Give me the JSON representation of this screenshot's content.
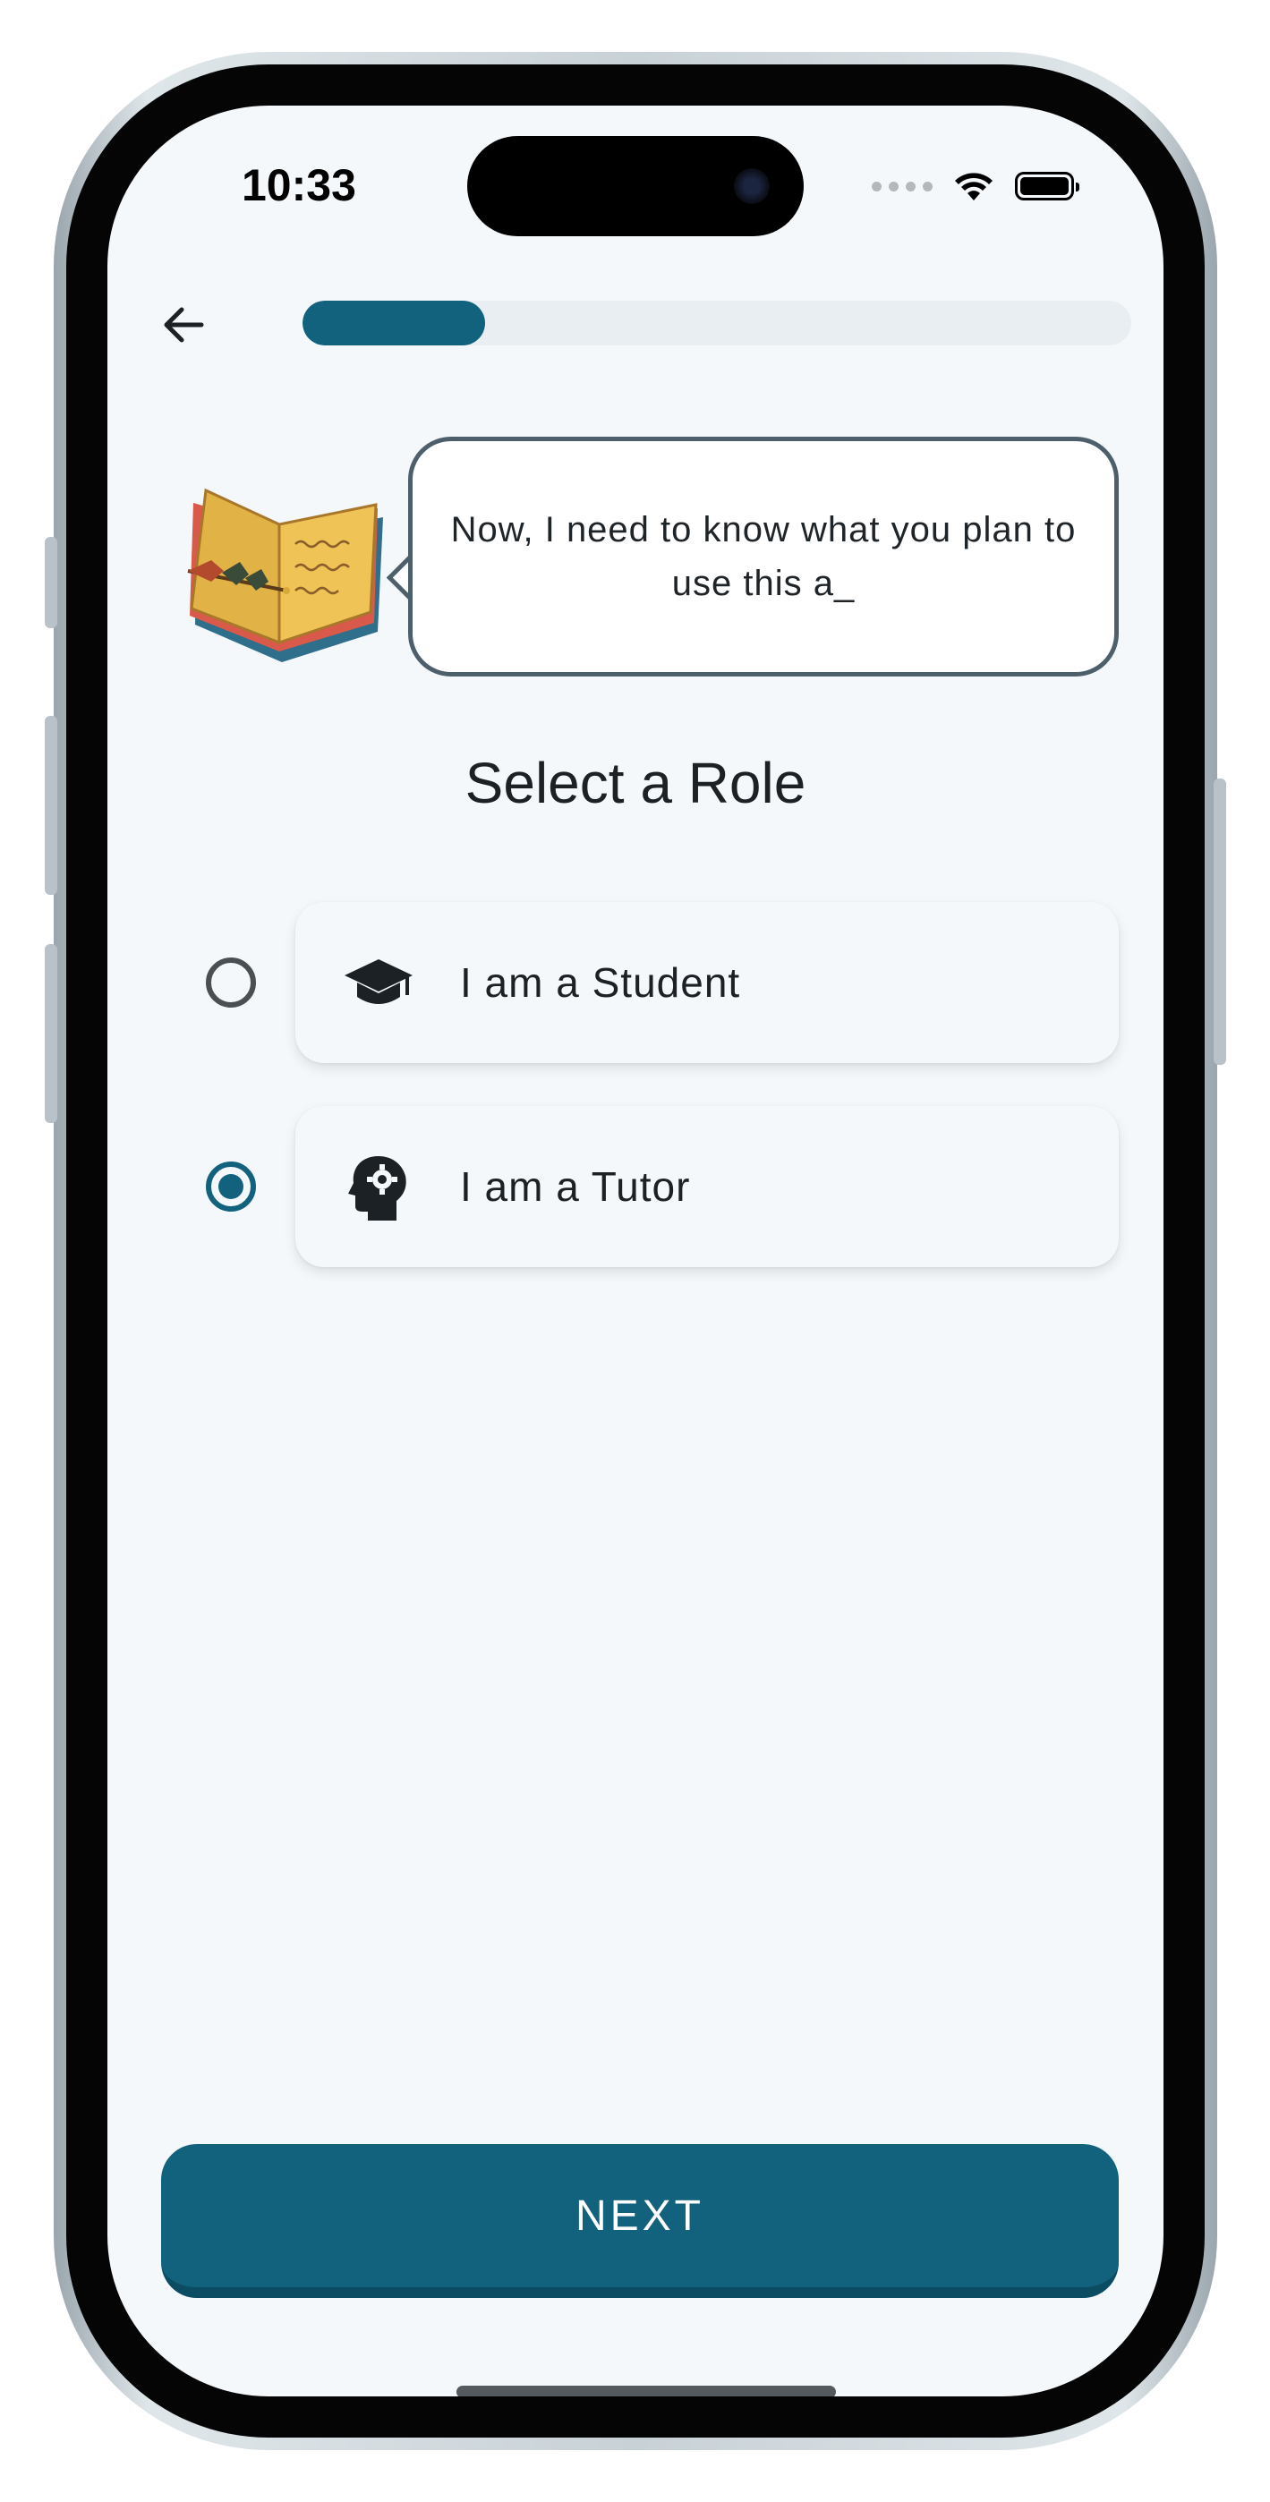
{
  "status_bar": {
    "time": "10:33"
  },
  "header": {
    "back_icon": "arrow-left-icon",
    "progress_fraction": 0.22
  },
  "assistant": {
    "mascot_icon": "open-book-icon",
    "message": "Now, I need to know what you plan to use this a_"
  },
  "page": {
    "title": "Select a Role"
  },
  "roles": [
    {
      "label": "I am a Student",
      "icon": "graduation-cap-icon",
      "selected": false
    },
    {
      "label": "I am a Tutor",
      "icon": "head-gear-icon",
      "selected": true
    }
  ],
  "footer": {
    "next_label": "NEXT"
  },
  "colors": {
    "primary": "#12627e",
    "background": "#f4f8fb",
    "progress_track": "#e9eef2",
    "text": "#1c2125"
  }
}
